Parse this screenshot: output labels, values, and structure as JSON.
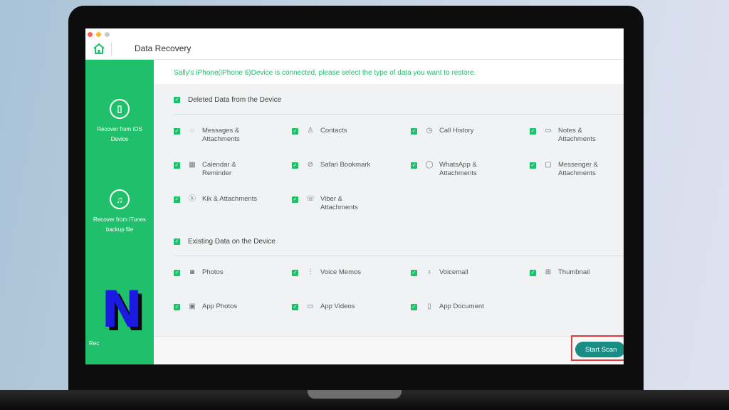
{
  "window": {
    "title": "Data Recovery"
  },
  "colors": {
    "accent": "#1fbf6b",
    "button": "#1a8c84",
    "highlight": "#e03a3a"
  },
  "sidebar": {
    "items": [
      {
        "label": "Recover from iOS Device",
        "icon": "phone-restore-icon"
      },
      {
        "label": "Recover from iTunes backup file",
        "icon": "music-note-icon"
      },
      {
        "label": "Rec",
        "icon": "cloud-icon"
      }
    ],
    "overlay_logo": "N"
  },
  "notice": "Sally's iPhone(iPhone 6)Device is connected, please select the type of data you want to restore.",
  "sections": [
    {
      "title": "Deleted Data from the Device",
      "items": [
        {
          "label": "Messages & Attachments",
          "icon": "message-icon"
        },
        {
          "label": "Contacts",
          "icon": "contacts-icon"
        },
        {
          "label": "Call History",
          "icon": "clock-icon"
        },
        {
          "label": "Notes & Attachments",
          "icon": "notes-icon"
        },
        {
          "label": "Calendar & Reminder",
          "icon": "calendar-icon"
        },
        {
          "label": "Safari Bookmark",
          "icon": "compass-icon"
        },
        {
          "label": "WhatsApp & Attachments",
          "icon": "whatsapp-icon"
        },
        {
          "label": "Messenger & Attachments",
          "icon": "messenger-icon"
        },
        {
          "label": "Kik & Attachments",
          "icon": "kik-icon"
        },
        {
          "label": "Viber & Attachments",
          "icon": "viber-icon"
        }
      ]
    },
    {
      "title": "Existing Data on the Device",
      "items": [
        {
          "label": "Photos",
          "icon": "camera-icon"
        },
        {
          "label": "Voice Memos",
          "icon": "waveform-icon"
        },
        {
          "label": "Voicemail",
          "icon": "microphone-icon"
        },
        {
          "label": "Thumbnail",
          "icon": "thumbnail-icon"
        },
        {
          "label": "App Photos",
          "icon": "image-icon"
        },
        {
          "label": "App Videos",
          "icon": "video-icon"
        },
        {
          "label": "App Document",
          "icon": "document-icon"
        }
      ]
    }
  ],
  "footer": {
    "start_scan": "Start Scan"
  }
}
